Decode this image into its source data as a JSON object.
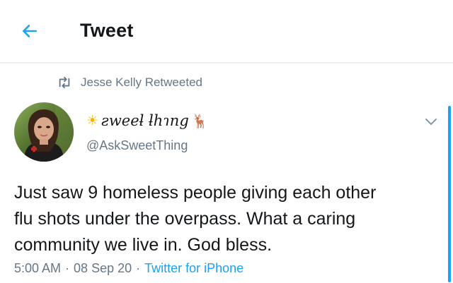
{
  "header": {
    "back_icon": "arrow-left-icon",
    "title": "Tweet"
  },
  "retweet_context": {
    "icon": "retweet-icon",
    "text": "Jesse Kelly Retweeted"
  },
  "tweet": {
    "author": {
      "avatar": "avatar-photo",
      "name_prefix_emoji": "☀",
      "display_name": "ƨweeƚ ƚhɿng",
      "name_suffix_emoji": "🦌",
      "username": "@AskSweetThing"
    },
    "more_icon": "chevron-down-icon",
    "text_lines": [
      "Just saw 9 homeless people giving each other",
      "flu shots under the overpass. What a caring",
      "community we live in. God bless."
    ],
    "meta": {
      "time": "5:00 AM",
      "separator": "·",
      "date": "08 Sep 20",
      "source": "Twitter for iPhone"
    }
  },
  "colors": {
    "accent": "#1da1f2",
    "secondary_text": "#657786",
    "primary_text": "#14171a",
    "divider": "#e6ecf0"
  }
}
